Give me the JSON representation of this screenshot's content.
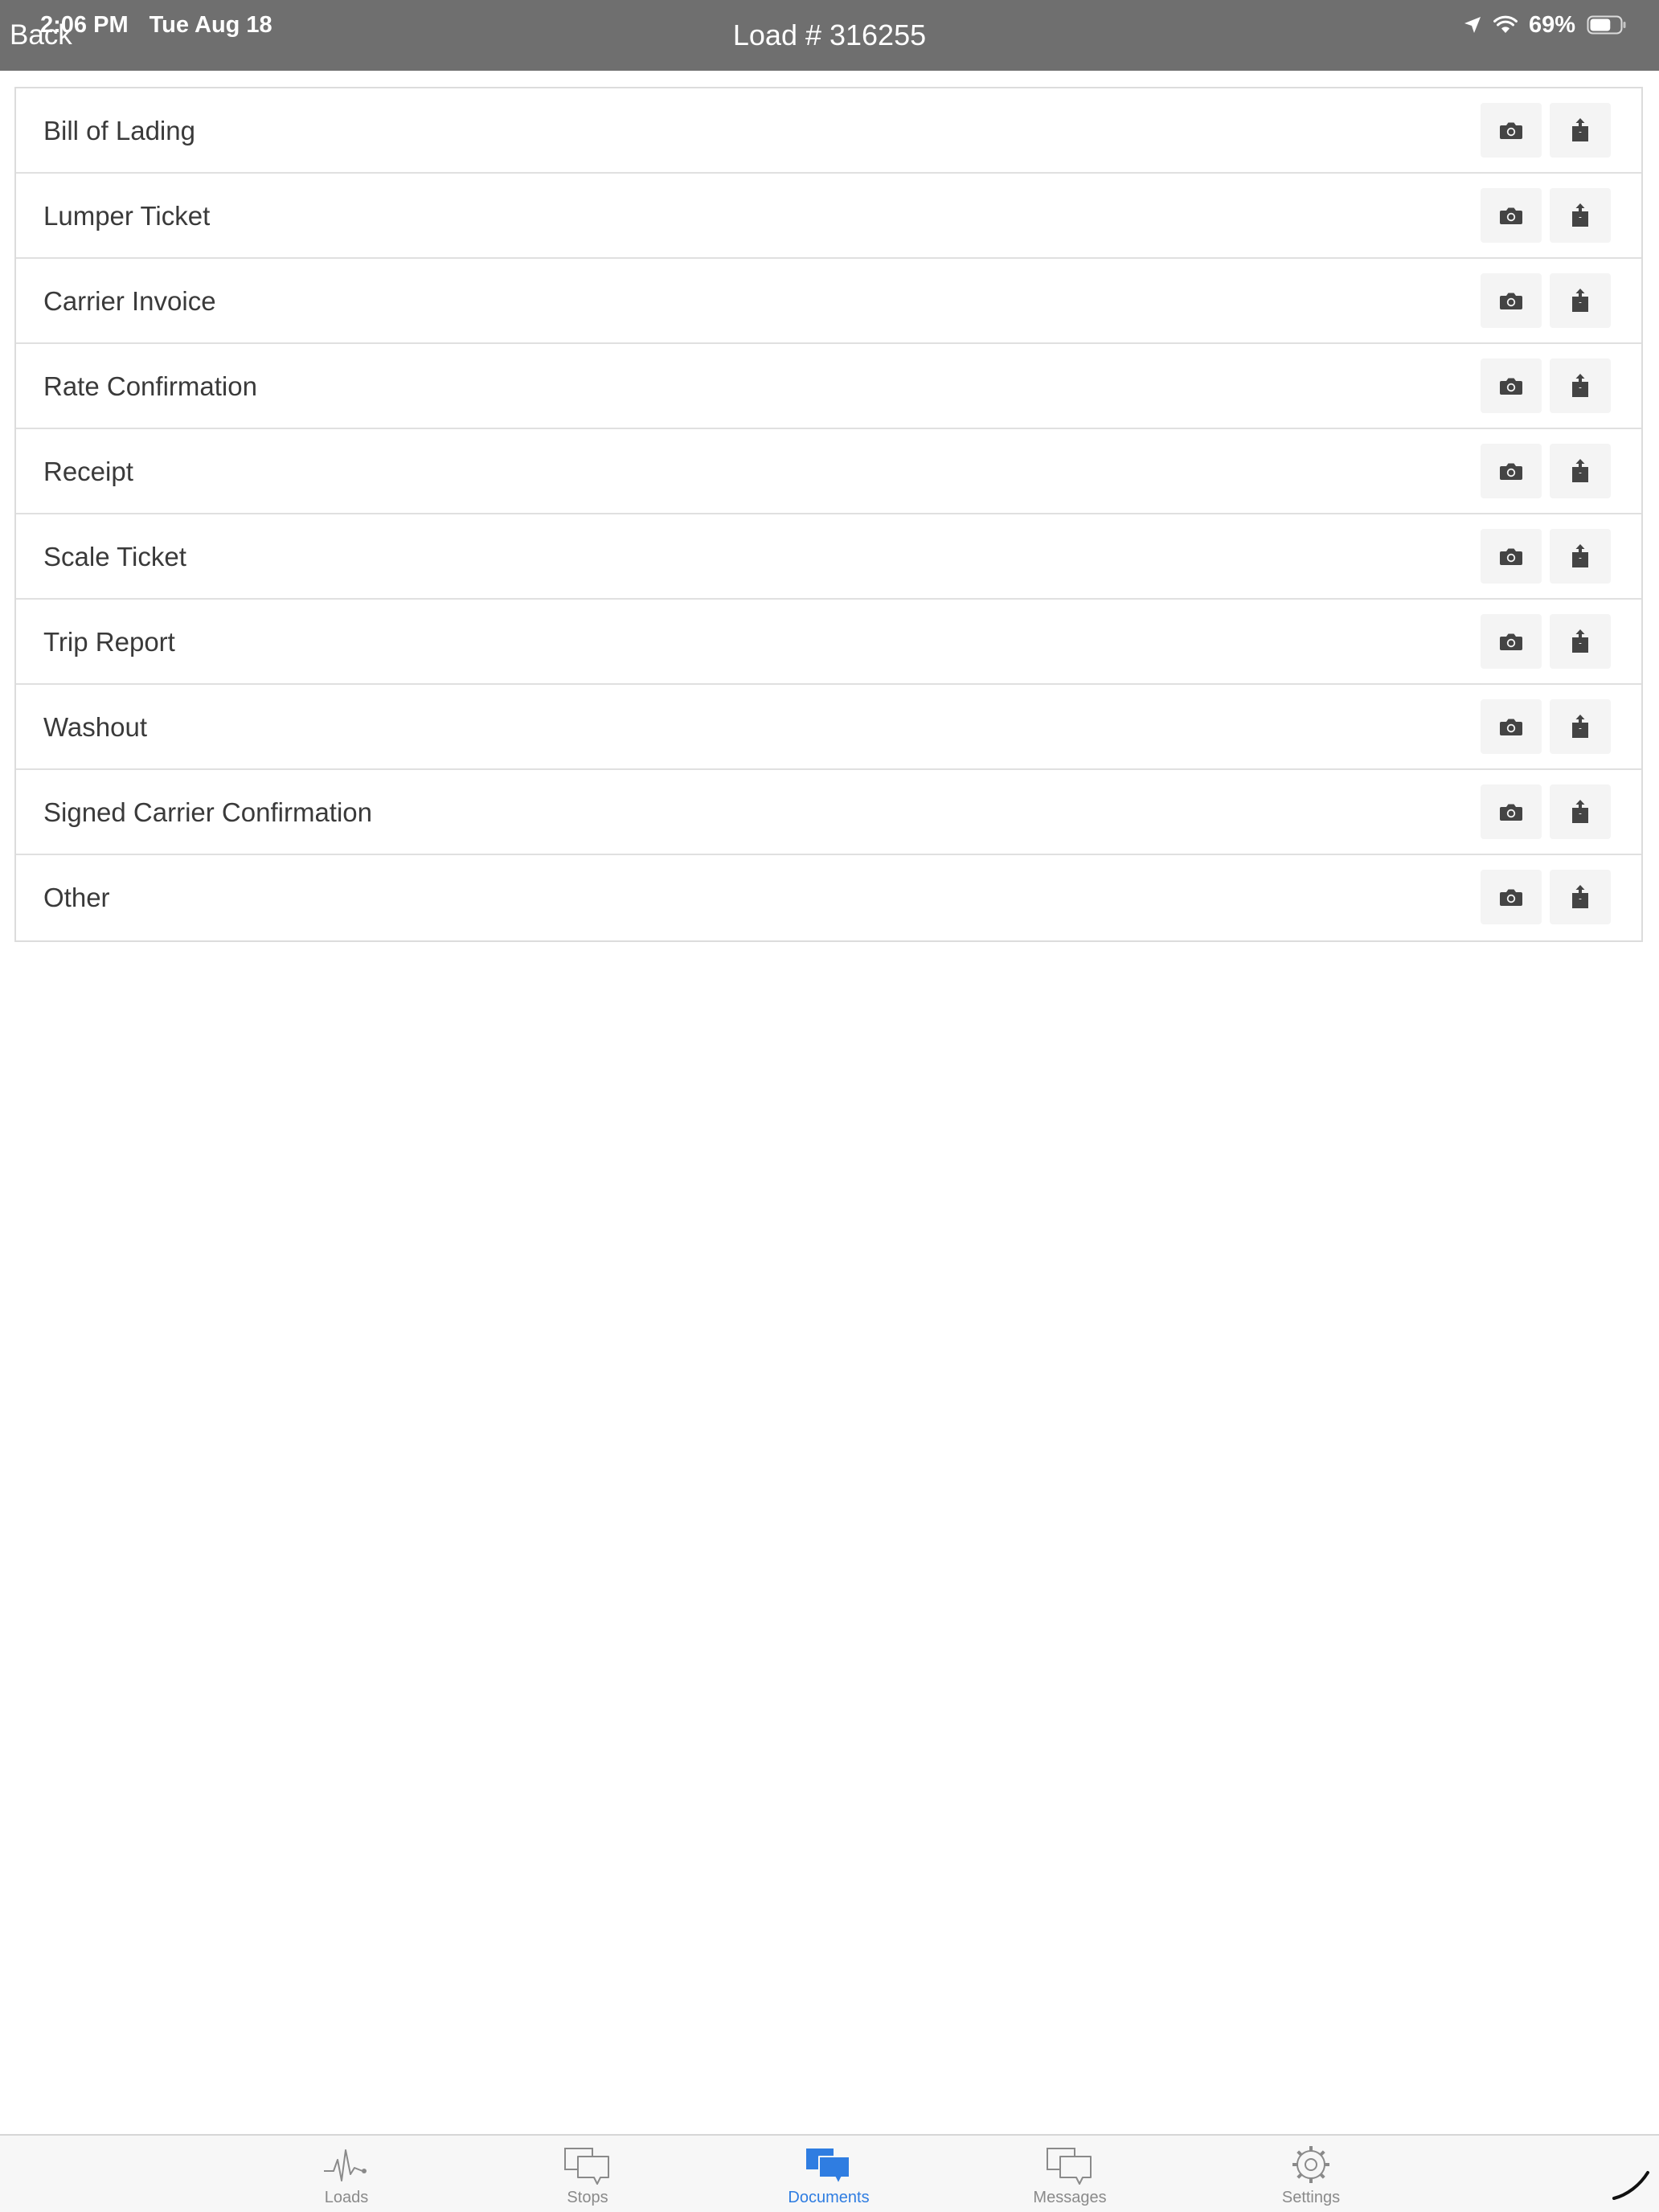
{
  "status_bar": {
    "time": "2:06 PM",
    "date": "Tue Aug 18",
    "battery": "69%",
    "battery_level": 0.69
  },
  "nav": {
    "back_label": "Back",
    "title": "Load # 316255"
  },
  "documents": [
    {
      "label": "Bill of Lading"
    },
    {
      "label": "Lumper Ticket"
    },
    {
      "label": "Carrier Invoice"
    },
    {
      "label": "Rate Confirmation"
    },
    {
      "label": "Receipt"
    },
    {
      "label": "Scale Ticket"
    },
    {
      "label": "Trip Report"
    },
    {
      "label": "Washout"
    },
    {
      "label": "Signed Carrier Confirmation"
    },
    {
      "label": "Other"
    }
  ],
  "row_actions": {
    "camera_icon": "camera-icon",
    "upload_icon": "share-upload-icon"
  },
  "tabs": [
    {
      "label": "Loads",
      "icon": "pulse-icon",
      "active": false
    },
    {
      "label": "Stops",
      "icon": "chat-bubbles-icon",
      "active": false
    },
    {
      "label": "Documents",
      "icon": "chat-bubbles-filled-icon",
      "active": true
    },
    {
      "label": "Messages",
      "icon": "chat-bubbles-icon",
      "active": false
    },
    {
      "label": "Settings",
      "icon": "gear-icon",
      "active": false
    }
  ],
  "colors": {
    "header_bg": "#6f6f6f",
    "accent": "#2f7de1",
    "tab_inactive": "#8a8a8a",
    "action_bg": "#f4f4f4"
  }
}
